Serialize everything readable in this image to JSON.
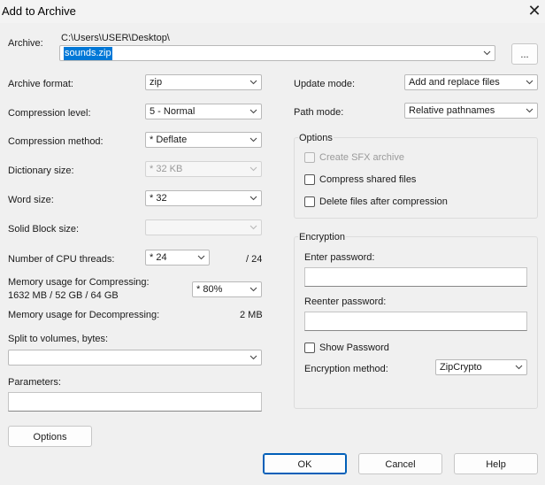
{
  "window": {
    "title": "Add to Archive"
  },
  "archive": {
    "label": "Archive:",
    "path": "C:\\Users\\USER\\Desktop\\",
    "filename": "sounds.zip",
    "browse_label": "..."
  },
  "left": {
    "format_label": "Archive format:",
    "format_value": "zip",
    "level_label": "Compression level:",
    "level_value": "5 - Normal",
    "method_label": "Compression method:",
    "method_value": "*  Deflate",
    "dict_label": "Dictionary size:",
    "dict_value": "*  32 KB",
    "word_label": "Word size:",
    "word_value": "*  32",
    "solid_label": "Solid Block size:",
    "solid_value": "",
    "threads_label": "Number of CPU threads:",
    "threads_value": "*  24",
    "threads_total": "/ 24",
    "mem_comp_label": "Memory usage for Compressing:",
    "mem_comp_detail": "1632 MB / 52 GB / 64 GB",
    "mem_comp_value": "*  80%",
    "mem_decomp_label": "Memory usage for Decompressing:",
    "mem_decomp_value": "2 MB",
    "split_label": "Split to volumes, bytes:",
    "split_value": "",
    "params_label": "Parameters:",
    "params_value": ""
  },
  "right": {
    "update_label": "Update mode:",
    "update_value": "Add and replace files",
    "path_label": "Path mode:",
    "path_value": "Relative pathnames",
    "options": {
      "title": "Options",
      "sfx": "Create SFX archive",
      "shared": "Compress shared files",
      "delete": "Delete files after compression"
    },
    "encryption": {
      "title": "Encryption",
      "enter_label": "Enter password:",
      "reenter_label": "Reenter password:",
      "show_label": "Show Password",
      "method_label": "Encryption method:",
      "method_value": "ZipCrypto"
    }
  },
  "buttons": {
    "options": "Options",
    "ok": "OK",
    "cancel": "Cancel",
    "help": "Help"
  },
  "colors": {
    "accent": "#005fb8",
    "selection": "#0078d7",
    "background": "#f0f0f0"
  },
  "icons": {
    "close": "close-icon",
    "dropdown": "chevron-down-icon"
  }
}
